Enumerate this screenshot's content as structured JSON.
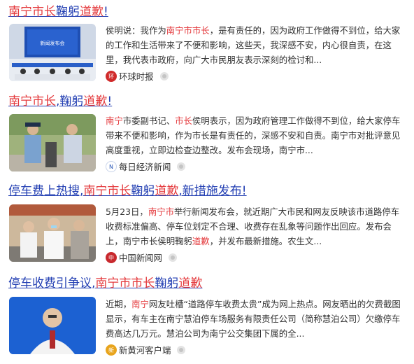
{
  "results": [
    {
      "title": [
        "南宁市长",
        "鞠躬",
        "道歉",
        "!"
      ],
      "snippet": "侯明说：我作为南宁市市长，是有责任的，因为政府工作做得不到位，给大家的工作和生活带来了不便和影响，这些天，我深感不安，内心很自责，在这里，我代表市政府，向广大市民朋友表示深刻的检讨和...",
      "snippet_hl": [
        "南宁市市长"
      ],
      "source": "环球时报",
      "source_icon": "huanqiu-logo-icon",
      "thumb_caption": "新闻发布会"
    },
    {
      "title": [
        "南宁市长",
        ",",
        "鞠躬",
        "道歉",
        "!"
      ],
      "snippet": "南宁市委副书记、市长侯明表示，因为政府管理工作做得不到位，给大家停车带来不便和影响，作为市长是有责任的，深感不安和自责。南宁市对批评意见高度重视，立即边检查边整改。发布会现场，南宁市...",
      "snippet_hl": [
        "南宁",
        "市长"
      ],
      "source": "每日经济新闻",
      "source_icon": "nbd-logo-icon"
    },
    {
      "title": [
        "停车费上热搜,",
        "南宁市长",
        "鞠躬",
        "道歉",
        ",新措施发布!"
      ],
      "snippet": "5月23日，南宁市举行新闻发布会，就近期广大市民和网友反映该市道路停车收费标准偏高、停车位划定不合理、收费存在乱象等问题作出回应。发布会上，南宁市长侯明鞠躬道歉，并发布最新措施。农生文...",
      "snippet_hl": [
        "南宁市",
        "道歉"
      ],
      "source": "中国新闻网",
      "source_icon": "chinanews-logo-icon"
    },
    {
      "title": [
        "停车收费引争议,",
        "南宁市",
        "市长",
        "鞠躬",
        "道歉"
      ],
      "snippet": "近期，南宁网友吐槽“道路停车收费太贵”成为网上热点。网友晒出的欠费截图显示，有车主在南宁慧泊停车场服务有限责任公司（简称慧泊公司）欠缴停车费高达几万元。慧泊公司为南宁公交集团下属的全...",
      "snippet_hl": [
        "南宁"
      ],
      "source": "新黄河客户端",
      "source_icon": "xinhuanghe-logo-icon"
    }
  ],
  "colors": {
    "title": "#2440b3",
    "highlight": "#e4393c",
    "text": "#333333"
  }
}
